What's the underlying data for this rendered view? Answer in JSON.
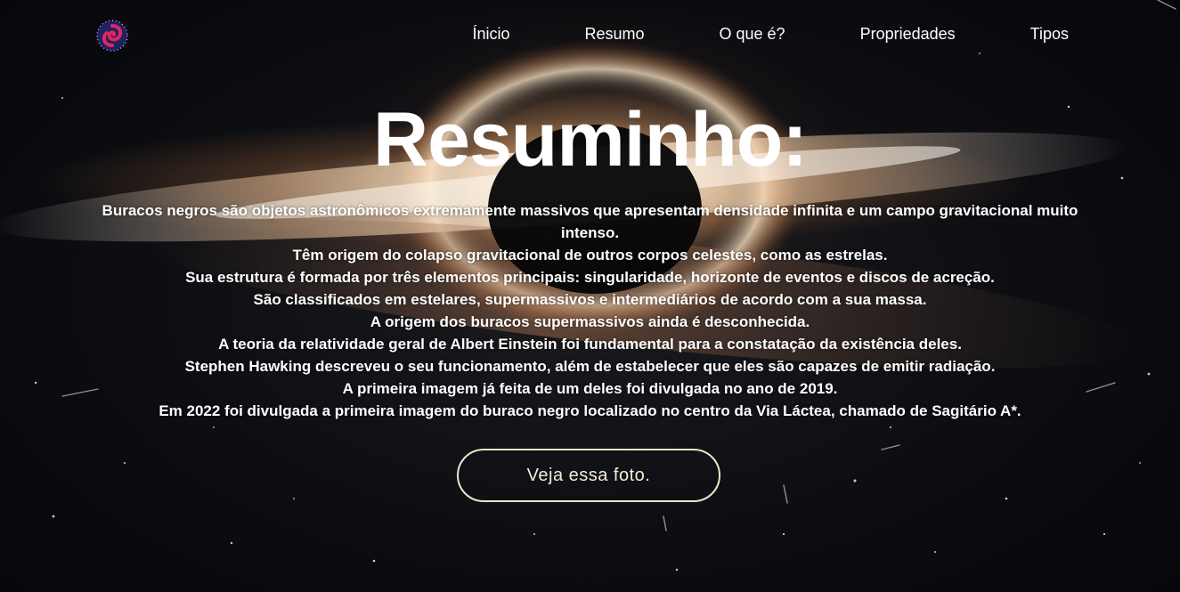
{
  "nav": {
    "logo_icon": "galaxy-spiral-icon",
    "links": [
      "Ínicio",
      "Resumo",
      "O que é?",
      "Propriedades",
      "Tipos"
    ]
  },
  "hero": {
    "title": "Resuminho:",
    "lines": [
      "Buracos negros são objetos astronômicos extremamente massivos que apresentam densidade infinita e um campo gravitacional muito intenso.",
      "Têm origem do colapso gravitacional de outros corpos celestes, como as estrelas.",
      "Sua estrutura é formada por três elementos principais: singularidade, horizonte de eventos e discos de acreção.",
      "São classificados em estelares, supermassivos e intermediários de acordo com a sua massa.",
      "A origem dos buracos supermassivos ainda é desconhecida.",
      "A teoria da relatividade geral de Albert Einstein foi fundamental para a constatação da existência deles.",
      "Stephen Hawking descreveu o seu funcionamento, além de estabelecer que eles são capazes de emitir radiação.",
      "A primeira imagem já feita de um deles foi divulgada no ano de 2019.",
      "Em 2022 foi divulgada a primeira imagem do buraco negro localizado no centro da Via Láctea, chamado de Sagitário A*."
    ],
    "cta_label": "Veja essa foto."
  },
  "colors": {
    "text": "#ffffff",
    "button_border": "#efe4cc",
    "logo_accent": "#e5245a",
    "logo_ring": "#2b3a8f"
  }
}
